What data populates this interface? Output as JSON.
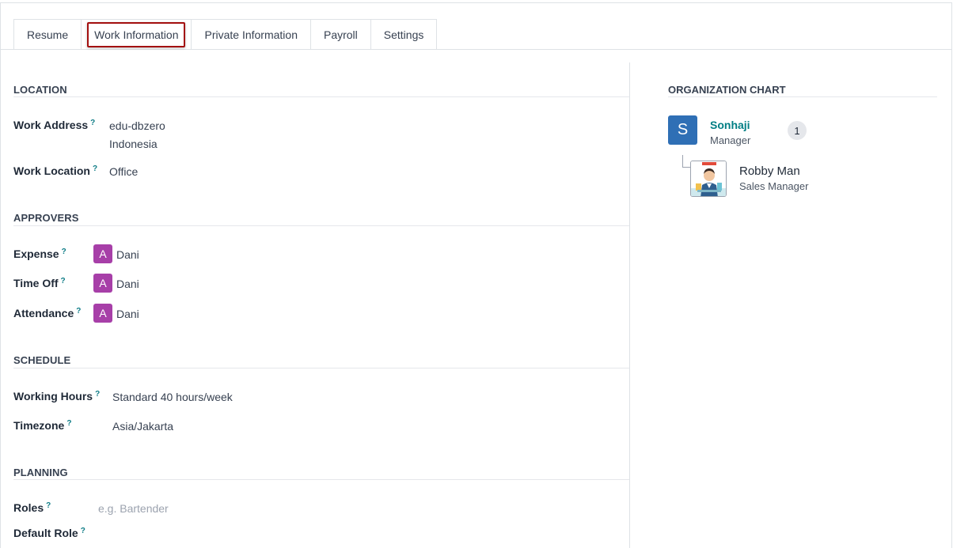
{
  "tabs": [
    {
      "label": "Resume"
    },
    {
      "label": "Work Information"
    },
    {
      "label": "Private Information"
    },
    {
      "label": "Payroll"
    },
    {
      "label": "Settings"
    }
  ],
  "location": {
    "title": "LOCATION",
    "work_address_label": "Work Address",
    "work_address_line1": "edu-dbzero",
    "work_address_line2": "Indonesia",
    "work_location_label": "Work Location",
    "work_location_value": "Office"
  },
  "approvers": {
    "title": "APPROVERS",
    "avatar_letter": "A",
    "items": [
      {
        "label": "Expense",
        "name": "Dani"
      },
      {
        "label": "Time Off",
        "name": "Dani"
      },
      {
        "label": "Attendance",
        "name": "Dani"
      }
    ]
  },
  "schedule": {
    "title": "SCHEDULE",
    "working_hours_label": "Working Hours",
    "working_hours_value": "Standard 40 hours/week",
    "timezone_label": "Timezone",
    "timezone_value": "Asia/Jakarta"
  },
  "planning": {
    "title": "PLANNING",
    "roles_label": "Roles",
    "roles_placeholder": "e.g. Bartender",
    "default_role_label": "Default Role"
  },
  "help_mark": "?",
  "org_chart": {
    "title": "ORGANIZATION CHART",
    "manager_initial": "S",
    "manager_name": "Sonhaji",
    "manager_role": "Manager",
    "subordinate_count": "1",
    "employee_name": "Robby Man",
    "employee_role": "Sales Manager"
  },
  "colors": {
    "accent": "#017e84",
    "approver_avatar": "#a73fa8",
    "manager_avatar": "#2f6fb5",
    "highlight": "#a30f0f"
  }
}
